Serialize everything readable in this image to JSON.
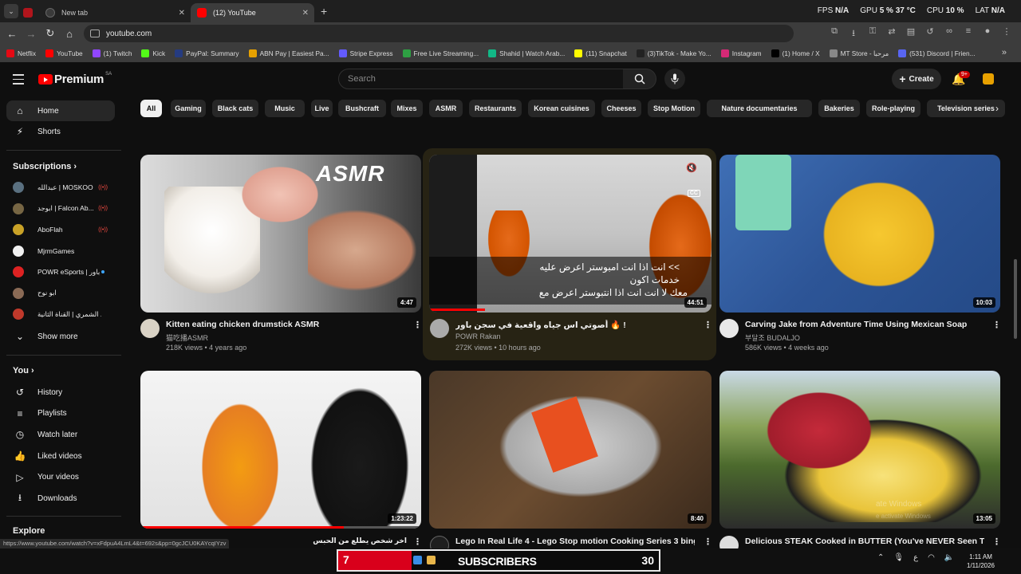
{
  "browser": {
    "tabs": [
      {
        "title": "",
        "fav_color": "#b1151c"
      },
      {
        "title": "New tab",
        "fav_color": "#3a3a3a"
      },
      {
        "title": "(12) YouTube",
        "fav_color": "#ff0000"
      }
    ],
    "perf": {
      "fps_label": "FPS",
      "fps_value": "N/A",
      "gpu_label": "GPU",
      "gpu_value": "5 %",
      "gpu_temp": "37 °C",
      "cpu_label": "CPU",
      "cpu_value": "10 %",
      "lat_label": "LAT",
      "lat_value": "N/A"
    },
    "url": "youtube.com",
    "bookmarks": [
      {
        "label": "Netflix",
        "color": "#e50914"
      },
      {
        "label": "YouTube",
        "color": "#ff0000"
      },
      {
        "label": "(1) Twitch",
        "color": "#9146ff"
      },
      {
        "label": "Kick",
        "color": "#53fc18"
      },
      {
        "label": "PayPal: Summary",
        "color": "#253b80"
      },
      {
        "label": "ABN Pay | Easiest Pa...",
        "color": "#e6a100"
      },
      {
        "label": "Stripe Express",
        "color": "#635bff"
      },
      {
        "label": "Free Live Streaming...",
        "color": "#2ea043"
      },
      {
        "label": "Shahid | Watch Arab...",
        "color": "#12b886"
      },
      {
        "label": "(11) Snapchat",
        "color": "#fffc00"
      },
      {
        "label": "(3)TikTok - Make Yo...",
        "color": "#222222"
      },
      {
        "label": "Instagram",
        "color": "#d62976"
      },
      {
        "label": "(1) Home / X",
        "color": "#000000"
      },
      {
        "label": "MT Store - مرحبا",
        "color": "#888888"
      },
      {
        "label": "(531) Discord | Frien...",
        "color": "#5865f2"
      }
    ],
    "status_url": "https://www.youtube.com/watch?v=xFdpuA4LmL4&t=692s&pp=0gcJCU0KAYcqIYzv"
  },
  "header": {
    "logo_text": "Premium",
    "region": "SA",
    "search_placeholder": "Search",
    "create_label": "Create",
    "notif_count": "9+"
  },
  "sidebar": {
    "main": [
      {
        "label": "Home",
        "icon": "home-icon",
        "glyph": "⌂"
      },
      {
        "label": "Shorts",
        "icon": "shorts-icon",
        "glyph": "⚡"
      }
    ],
    "subs_title": "Subscriptions",
    "subs": [
      {
        "name": "عبدالله | MOSKOO",
        "color": "#5a7080",
        "live": true
      },
      {
        "name": "ابوجد | Falcon Ab...",
        "color": "#776644",
        "live": true
      },
      {
        "name": "AboFlah",
        "color": "#c9a227",
        "live": true
      },
      {
        "name": "MjrmGames",
        "color": "#f1f1f1",
        "live": false
      },
      {
        "name": "POWR eSports | باور",
        "color": "#d22",
        "live": false,
        "dot": true
      },
      {
        "name": "ابو نوح",
        "color": "#8a6a55",
        "live": false
      },
      {
        "name": "ابو عابد الشمري | القناة الثانية",
        "color": "#c0392b",
        "live": false
      }
    ],
    "show_more": "Show more",
    "you_title": "You",
    "you": [
      {
        "label": "History",
        "icon": "history-icon",
        "glyph": "↺"
      },
      {
        "label": "Playlists",
        "icon": "playlists-icon",
        "glyph": "≡"
      },
      {
        "label": "Watch later",
        "icon": "watch-later-icon",
        "glyph": "◷"
      },
      {
        "label": "Liked videos",
        "icon": "like-icon",
        "glyph": "👍"
      },
      {
        "label": "Your videos",
        "icon": "your-videos-icon",
        "glyph": "▷"
      },
      {
        "label": "Downloads",
        "icon": "download-icon",
        "glyph": "⭳"
      }
    ],
    "explore_title": "Explore"
  },
  "chips": [
    "All",
    "Gaming",
    "Black cats",
    "Music",
    "Live",
    "Bushcraft",
    "Mixes",
    "ASMR",
    "Restaurants",
    "Korean cuisines",
    "Cheeses",
    "Stop Motion",
    "Nature documentaries",
    "Bakeries",
    "Role-playing",
    "Television series"
  ],
  "videos": [
    {
      "title": "Kitten eating chicken drumstick ASMR",
      "channel": "猫吃播ASMR",
      "meta": "218K views • 4 years ago",
      "duration": "4:47",
      "thumb_text": "ASMR"
    },
    {
      "title": "أصوتي اس جياه واقعية في سجن باور 🔥 !",
      "channel": "POWR Rakan",
      "meta": "272K views • 10 hours ago",
      "duration": "44:51",
      "subtitle1": ">> انت اذا انت امبوستر اعرض عليه",
      "subtitle2": "خدمات اكون",
      "subtitle3": "معك لا انت انت اذا انتبوستر اعرض مع",
      "cc": "CC"
    },
    {
      "title": "Carving Jake from Adventure Time Using Mexican Soap",
      "channel": "부달조 BUDALJO",
      "meta": "586K views • 4 weeks ago",
      "duration": "10:03"
    },
    {
      "title": "اخر شخص يطلع من الحبس",
      "channel": "",
      "meta": "",
      "duration": "1:23:22"
    },
    {
      "title": "Lego In Real Life 4 - Lego Stop motion Cooking Series 3 binge",
      "channel": "",
      "meta": "",
      "duration": "8:40"
    },
    {
      "title": "Delicious STEAK Cooked in BUTTER (You've NEVER Seen This",
      "channel": "",
      "meta": "",
      "duration": "13:05"
    }
  ],
  "watermark": {
    "line1": "ate Windows",
    "line2": "e activate Windows"
  },
  "taskbar": {
    "promo_number": "7",
    "promo_text": "SUBSCRIBERS",
    "promo_count": "30",
    "time": "1:11 AM",
    "date": "1/11/2026",
    "lang": "ع"
  }
}
